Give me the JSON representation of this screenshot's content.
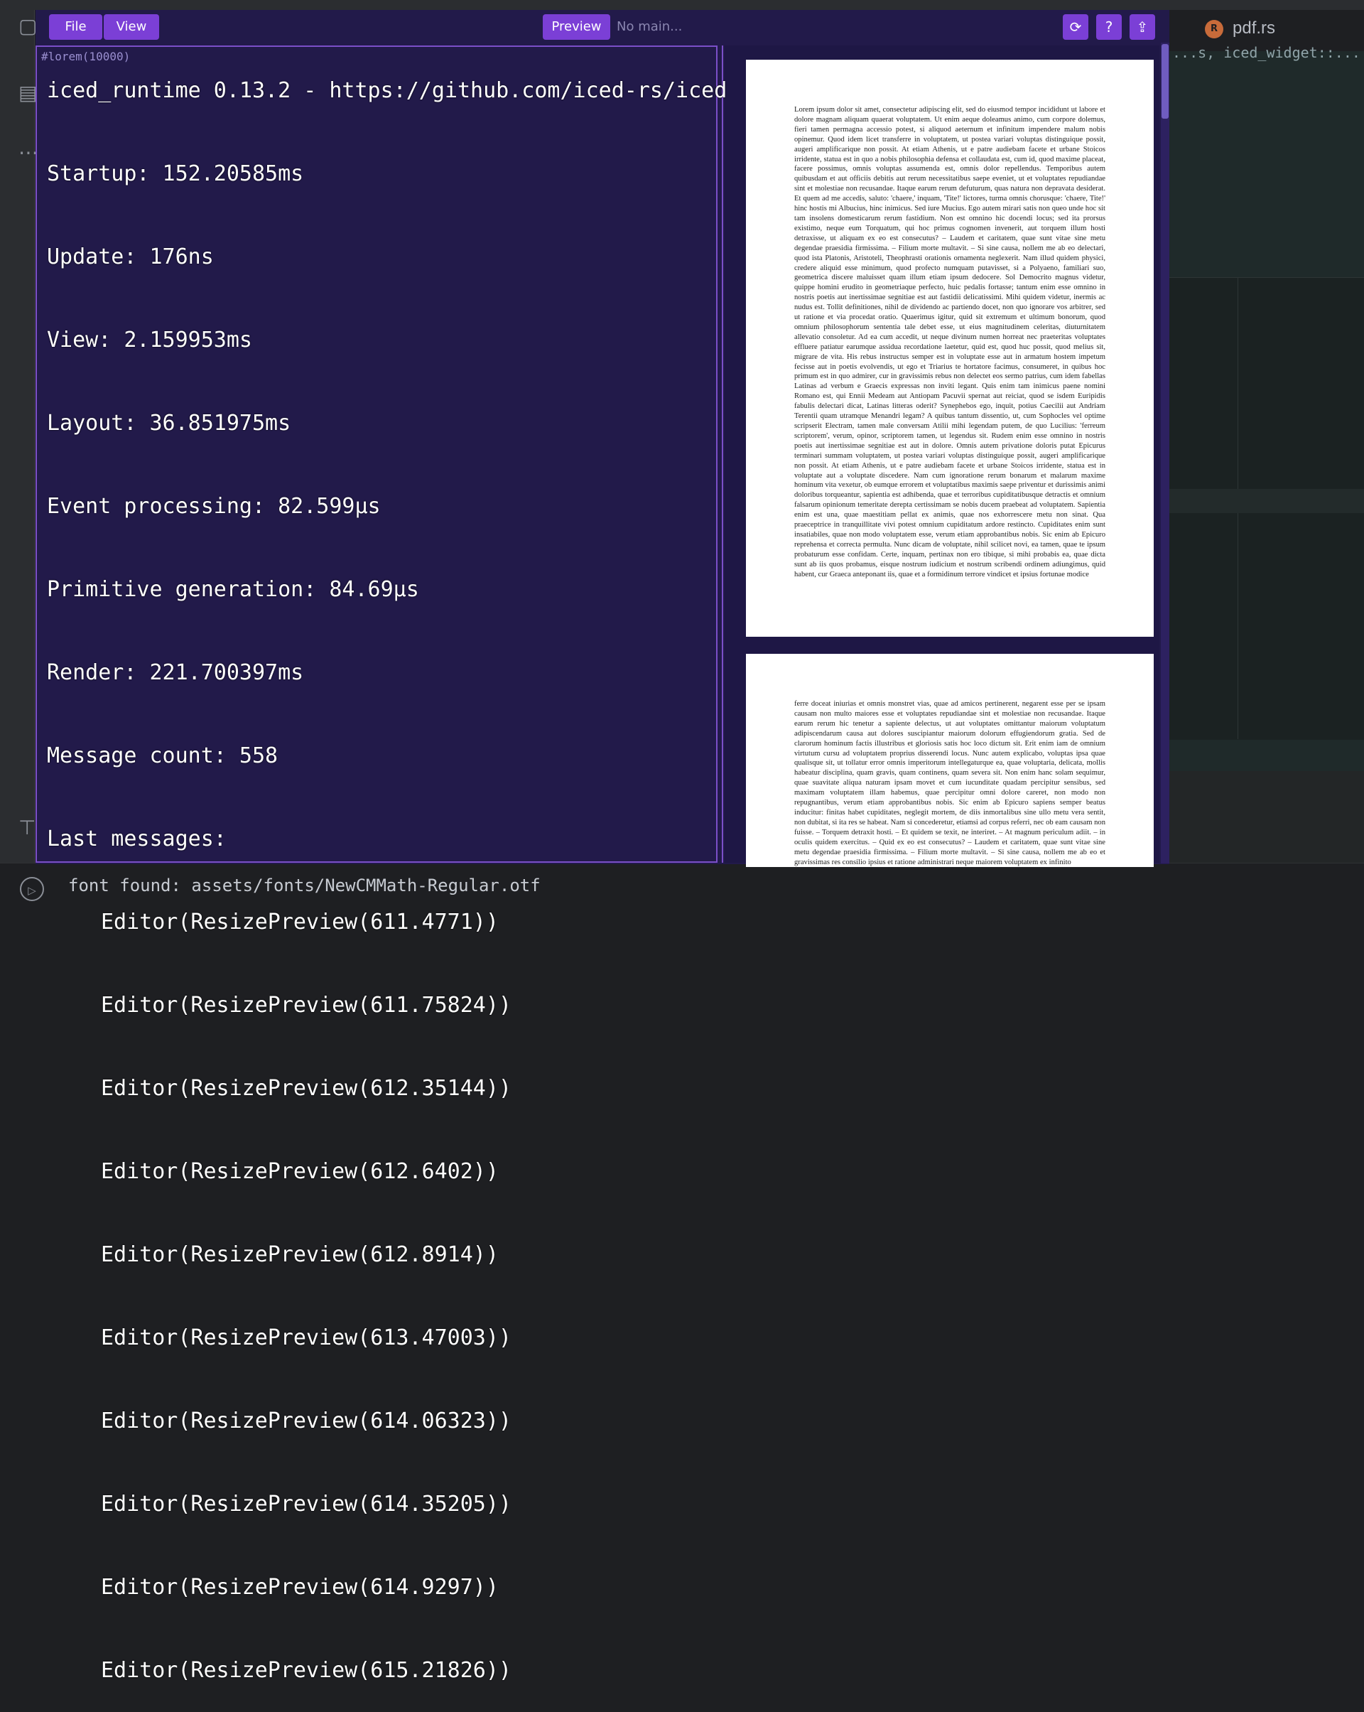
{
  "ide": {
    "tab_label": "pdf.rs",
    "tab_icon": "R",
    "code_snippet": "...s, iced_widget::...",
    "console_line": "font found: assets/fonts/NewCMMath-Regular.otf"
  },
  "app": {
    "menu": {
      "file": "File",
      "view": "View"
    },
    "preview_button": "Preview",
    "status": "No main...",
    "toolbar_icons": [
      "sync-icon",
      "help-icon",
      "export-icon"
    ],
    "editor_text": "#lorem(10000)",
    "scroll_position": 0.0
  },
  "debug_overlay": {
    "title": "iced_runtime 0.13.2 - https://github.com/iced-rs/iced",
    "stats": [
      "Startup: 152.20585ms",
      "Update: 176ns",
      "View: 2.159953ms",
      "Layout: 36.851975ms",
      "Event processing: 82.599μs",
      "Primitive generation: 84.69μs",
      "Render: 221.700397ms",
      "Message count: 558",
      "Last messages:"
    ],
    "messages": [
      "Editor(ResizePreview(611.4771))",
      "Editor(ResizePreview(611.75824))",
      "Editor(ResizePreview(612.35144))",
      "Editor(ResizePreview(612.6402))",
      "Editor(ResizePreview(612.8914))",
      "Editor(ResizePreview(613.47003))",
      "Editor(ResizePreview(614.06323))",
      "Editor(ResizePreview(614.35205))",
      "Editor(ResizePreview(614.9297))",
      "Editor(ResizePreview(615.21826))"
    ]
  },
  "preview": {
    "page1": "Lorem ipsum dolor sit amet, consectetur adipiscing elit, sed do eiusmod tempor incididunt ut labore et dolore magnam aliquam quaerat voluptatem. Ut enim aeque doleamus animo, cum corpore dolemus, fieri tamen permagna accessio potest, si aliquod aeternum et infinitum impendere malum nobis opinemur. Quod idem licet transferre in voluptatem, ut postea variari voluptas distinguique possit, augeri amplificarique non possit. At etiam Athenis, ut e patre audiebam facete et urbane Stoicos irridente, statua est in quo a nobis philosophia defensa et collaudata est, cum id, quod maxime placeat, facere possimus, omnis voluptas assumenda est, omnis dolor repellendus. Temporibus autem quibusdam et aut officiis debitis aut rerum necessitatibus saepe eveniet, ut et voluptates repudiandae sint et molestiae non recusandae. Itaque earum rerum defuturum, quas natura non depravata desiderat. Et quem ad me accedis, saluto: 'chaere,' inquam, 'Tite!' lictores, turma omnis chorusque: 'chaere, Tite!' hinc hostis mi Albucius, hinc inimicus. Sed iure Mucius. Ego autem mirari satis non queo unde hoc sit tam insolens domesticarum rerum fastidium. Non est omnino hic docendi locus; sed ita prorsus existimo, neque eum Torquatum, qui hoc primus cognomen invenerit, aut torquem illum hosti detraxisse, ut aliquam ex eo est consecutus? – Laudem et caritatem, quae sunt vitae sine metu degendae praesidia firmissima. – Filium morte multavit. – Si sine causa, nollem me ab eo delectari, quod ista Platonis, Aristoteli, Theophrasti orationis ornamenta neglexerit. Nam illud quidem physici, credere aliquid esse minimum, quod profecto numquam putavisset, si a Polyaeno, familiari suo, geometrica discere maluisset quam illum etiam ipsum dedocere. Sol Democrito magnus videtur, quippe homini erudito in geometriaque perfecto, huic pedalis fortasse; tantum enim esse omnino in nostris poetis aut inertissimae segnitiae est aut fastidii delicatissimi. Mihi quidem videtur, inermis ac nudus est. Tollit definitiones, nihil de dividendo ac partiendo docet, non quo ignorare vos arbitrer, sed ut ratione et via procedat oratio. Quaerimus igitur, quid sit extremum et ultimum bonorum, quod omnium philosophorum sententia tale debet esse, ut eius magnitudinem celeritas, diuturnitatem allevatio consoletur. Ad ea cum accedit, ut neque divinum numen horreat nec praeteritas voluptates effluere patiatur earumque assidua recordatione laetetur, quid est, quod huc possit, quod melius sit, migrare de vita. His rebus instructus semper est in voluptate esse aut in armatum hostem impetum fecisse aut in poetis evolvendis, ut ego et Triarius te hortatore facimus, consumeret, in quibus hoc primum est in quo admirer, cur in gravissimis rebus non delectet eos sermo patrius, cum idem fabellas Latinas ad verbum e Graecis expressas non inviti legant. Quis enim tam inimicus paene nomini Romano est, qui Ennii Medeam aut Antiopam Pacuvii spernat aut reiciat, quod se isdem Euripidis fabulis delectari dicat, Latinas litteras oderit? Synephebos ego, inquit, potius Caecilii aut Andriam Terentii quam utramque Menandri legam? A quibus tantum dissentio, ut, cum Sophocles vel optime scripserit Electram, tamen male conversam Atilii mihi legendam putem, de quo Lucilius: 'ferreum scriptorem', verum, opinor, scriptorem tamen, ut legendus sit. Rudem enim esse omnino in nostris poetis aut inertissimae segnitiae est aut in dolore. Omnis autem privatione doloris putat Epicurus terminari summam voluptatem, ut postea variari voluptas distinguique possit, augeri amplificarique non possit. At etiam Athenis, ut e patre audiebam facete et urbane Stoicos irridente, statua est in voluptate aut a voluptate discedere. Nam cum ignoratione rerum bonarum et malarum maxime hominum vita vexetur, ob eumque errorem et voluptatibus maximis saepe priventur et durissimis animi doloribus torqueantur, sapientia est adhibenda, quae et terroribus cupiditatibusque detractis et omnium falsarum opinionum temeritate derepta certissimam se nobis ducem praebeat ad voluptatem. Sapientia enim est una, quae maestitiam pellat ex animis, quae nos exhorrescere metu non sinat. Qua praeceptrice in tranquillitate vivi potest omnium cupiditatum ardore restincto. Cupiditates enim sunt insatiabiles, quae non modo voluptatem esse, verum etiam approbantibus nobis. Sic enim ab Epicuro reprehensa et correcta permulta. Nunc dicam de voluptate, nihil scilicet novi, ea tamen, quae te ipsum probaturum esse confidam. Certe, inquam, pertinax non ero tibique, si mihi probabis ea, quae dicta sunt ab iis quos probamus, eisque nostrum iudicium et nostrum scribendi ordinem adiungimus, quid habent, cur Graeca anteponant iis, quae et a formidinum terrore vindicet et ipsius fortunae modice",
    "page2": "ferre doceat iniurias et omnis monstret vias, quae ad amicos pertinerent, negarent esse per se ipsam causam non multo maiores esse et voluptates repudiandae sint et molestiae non recusandae. Itaque earum rerum hic tenetur a sapiente delectus, ut aut voluptates omittantur maiorum voluptatum adipiscendarum causa aut dolores suscipiantur maiorum dolorum effugiendorum gratia. Sed de clarorum hominum factis illustribus et gloriosis satis hoc loco dictum sit. Erit enim iam de omnium virtutum cursu ad voluptatem proprius disserendi locus. Nunc autem explicabo, voluptas ipsa quae qualisque sit, ut tollatur error omnis imperitorum intellegaturque ea, quae voluptaria, delicata, mollis habeatur disciplina, quam gravis, quam continens, quam severa sit. Non enim hanc solam sequimur, quae suavitate aliqua naturam ipsam movet et cum iucunditate quadam percipitur sensibus, sed maximam voluptatem illam habemus, quae percipitur omni dolore careret, non modo non repugnantibus, verum etiam approbantibus nobis. Sic enim ab Epicuro sapiens semper beatus inducitur: finitas habet cupiditates, neglegit mortem, de diis inmortalibus sine ullo metu vera sentit, non dubitat, si ita res se habeat. Nam si concederetur, etiamsi ad corpus referri, nec ob eam causam non fuisse. – Torquem detraxit hosti. – Et quidem se texit, ne interiret. – At magnum periculum adiit. – in oculis quidem exercitus. – Quid ex eo est consecutus? – Laudem et caritatem, quae sunt vitae sine metu degendae praesidia firmissima. – Filium morte multavit. – Si sine causa, nollem me ab eo et gravissimas res consilio ipsius et ratione administrari neque maiorem voluptatem ex infinito"
  }
}
